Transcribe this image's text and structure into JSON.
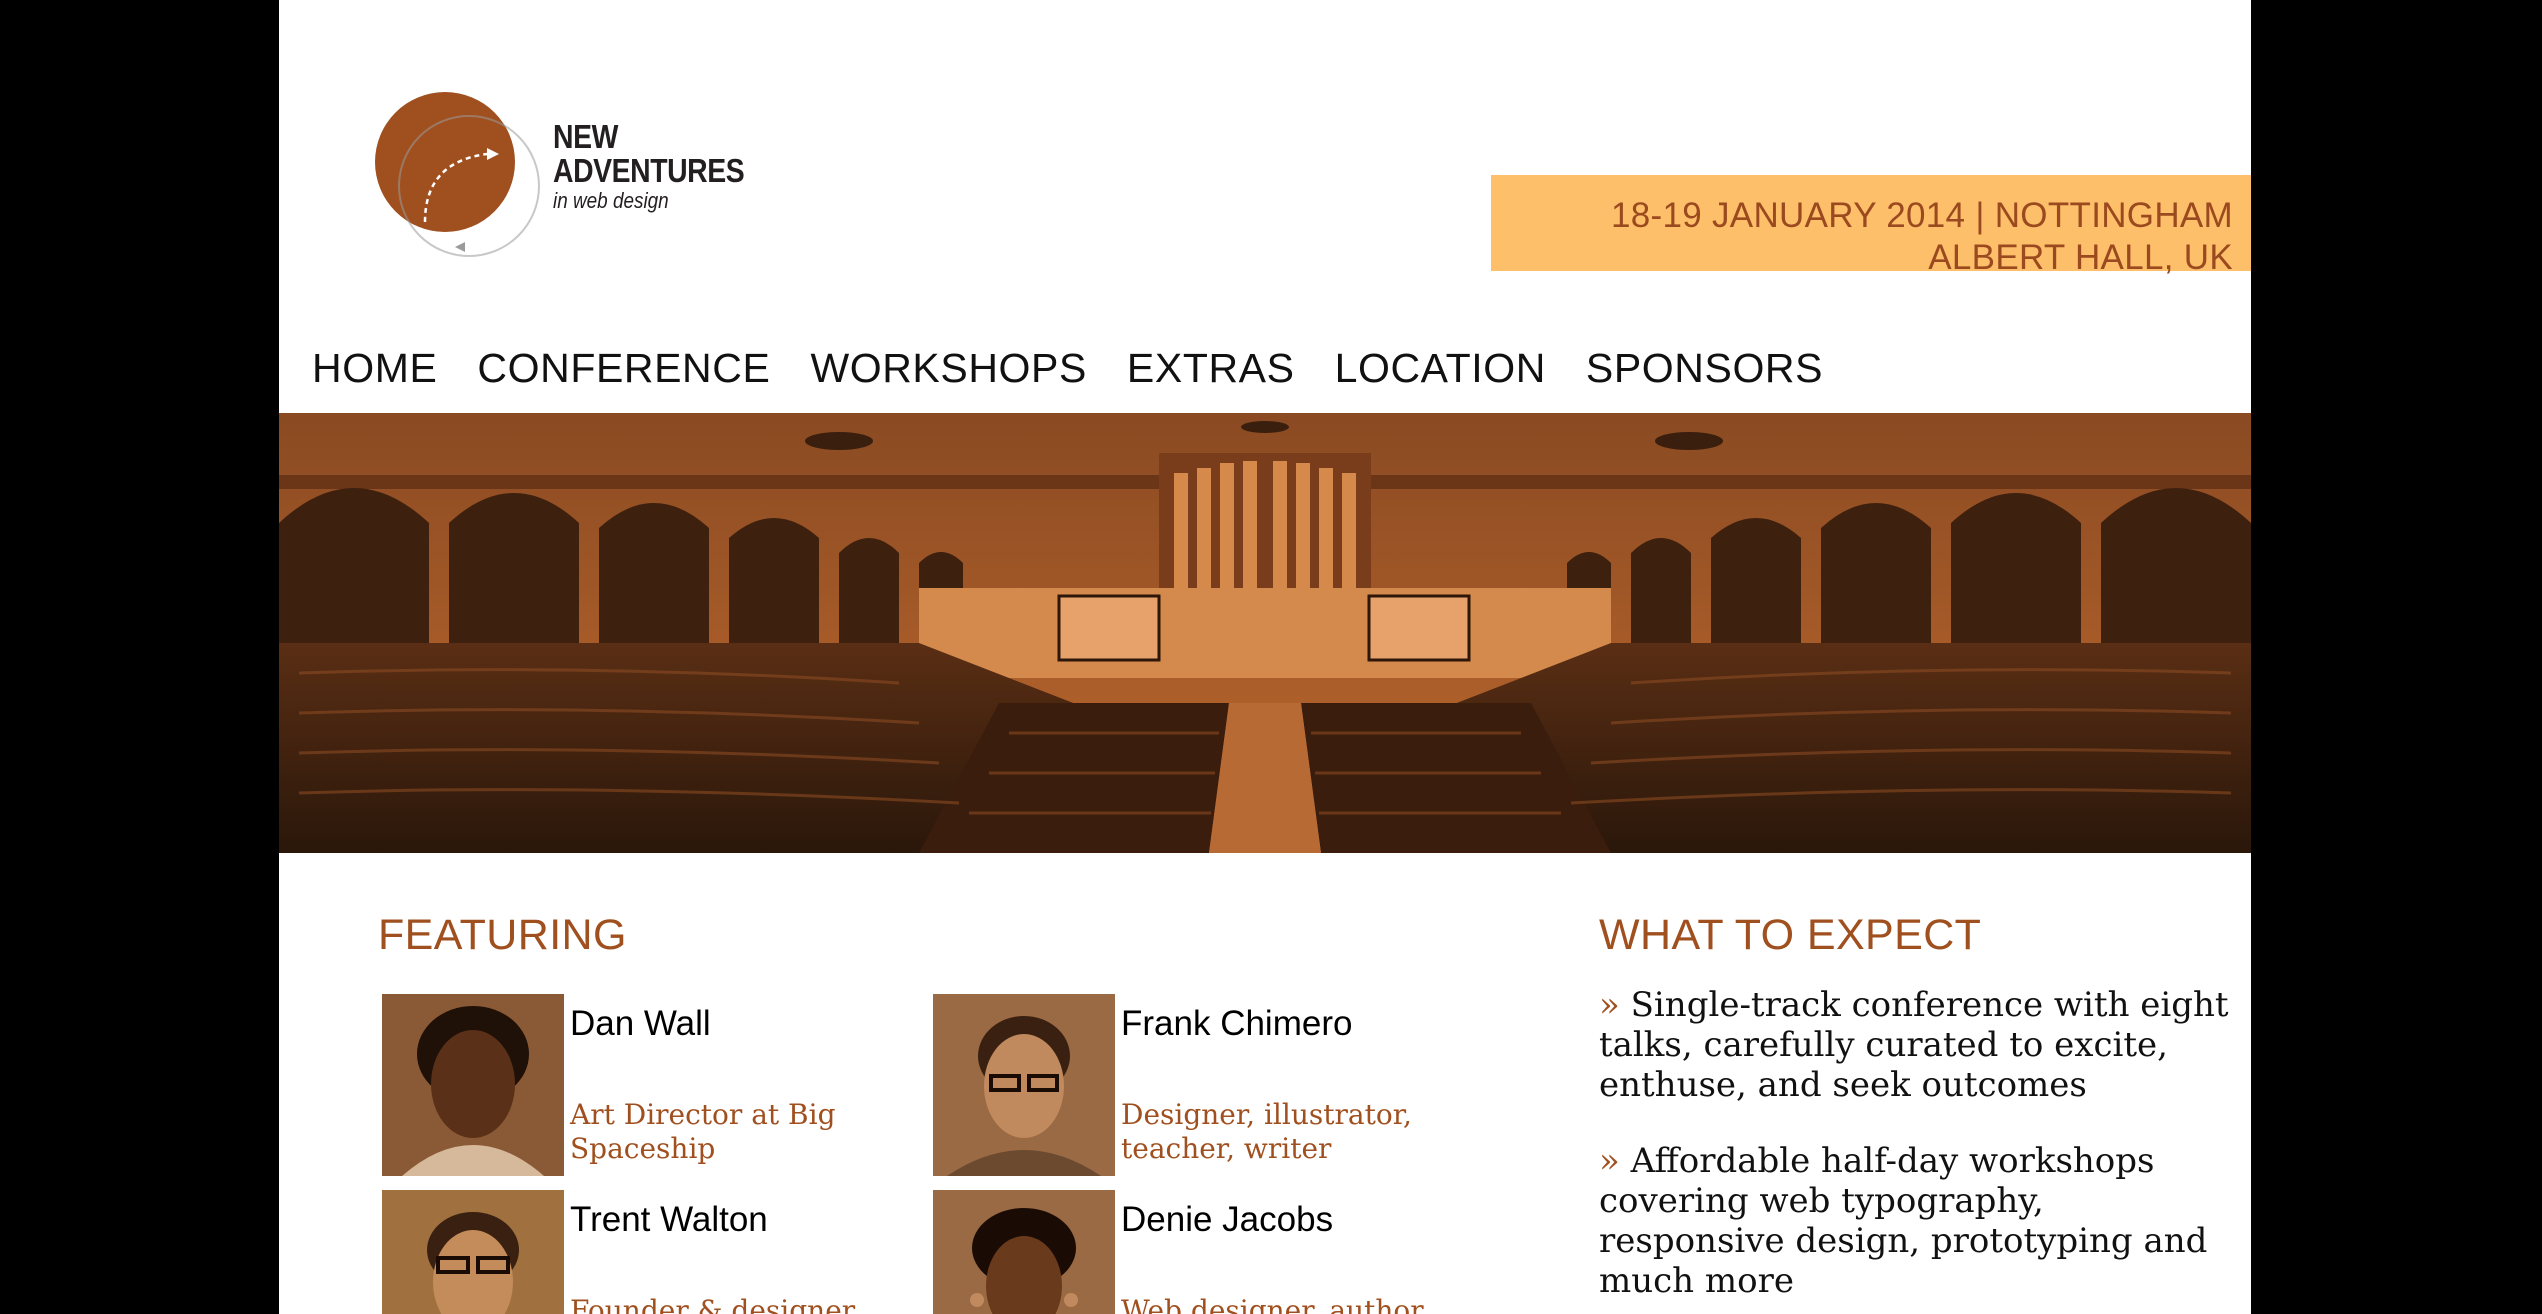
{
  "colors": {
    "accent": "#a0501f",
    "banner_bg": "#fdbf6a",
    "banner_text": "#9a4a1e",
    "page_bg": "#ffffff",
    "backdrop": "#000000",
    "hero_tint": "#9c4b1c"
  },
  "logo": {
    "line1": "NEW",
    "line2": "ADVENTURES",
    "tagline": "in web design"
  },
  "banner": {
    "line1": "18-19 JANUARY 2014 | NOTTINGHAM",
    "line2": "ALBERT HALL, UK"
  },
  "nav": {
    "items": [
      {
        "label": "HOME"
      },
      {
        "label": "CONFERENCE"
      },
      {
        "label": "WORKSHOPS"
      },
      {
        "label": "EXTRAS"
      },
      {
        "label": "LOCATION"
      },
      {
        "label": "SPONSORS"
      }
    ]
  },
  "hero": {
    "image_icon": "concert-hall-photo"
  },
  "featuring": {
    "heading": "FEATURING",
    "speakers": [
      {
        "name": "Dan Wall",
        "role": "Art Director at Big Spaceship"
      },
      {
        "name": "Frank Chimero",
        "role": "Designer, illustrator, teacher, writer"
      },
      {
        "name": "Trent Walton",
        "role": "Founder & designer at"
      },
      {
        "name": "Denie Jacobs",
        "role": "Web designer, author,"
      }
    ]
  },
  "expect": {
    "heading": "WHAT TO EXPECT",
    "bullet": "»",
    "items": [
      {
        "text": "Single-track conference with eight talks, carefully curated to excite, enthuse, and seek outcomes"
      },
      {
        "text": "Affordable half-day workshops covering web typography, responsive design, prototyping and much more"
      }
    ]
  }
}
